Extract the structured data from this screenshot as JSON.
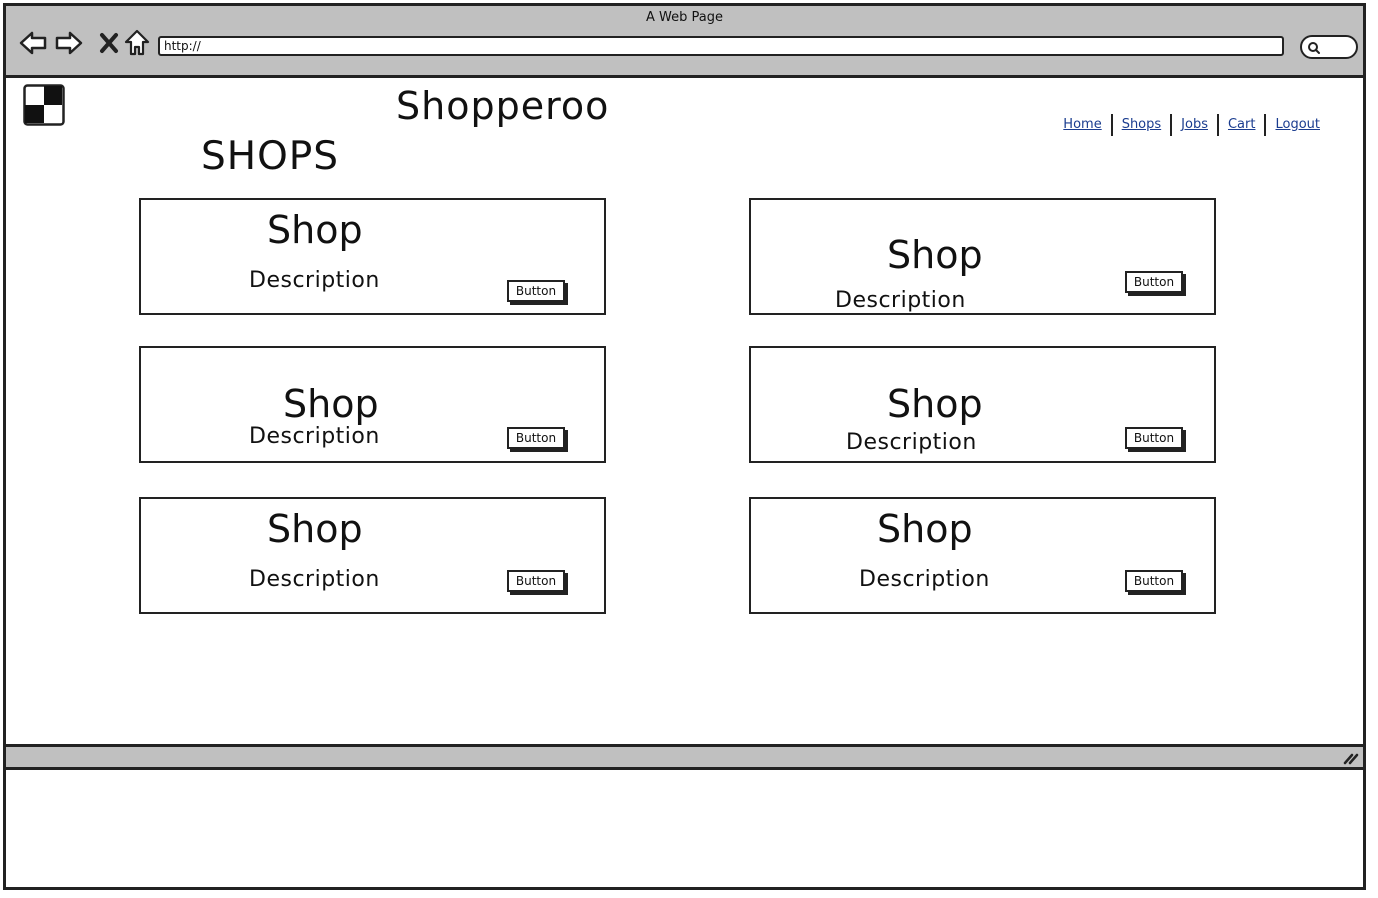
{
  "window": {
    "title": "A Web Page",
    "url": "http://"
  },
  "header": {
    "app_title": "Shopperoo",
    "page_heading": "SHOPS",
    "nav": [
      "Home",
      "Shops",
      "Jobs",
      "Cart",
      "Logout"
    ]
  },
  "shops": [
    {
      "title": "Shop",
      "description": "Description",
      "button": "Button"
    },
    {
      "title": "Shop",
      "description": "Description",
      "button": "Button"
    },
    {
      "title": "Shop",
      "description": "Description",
      "button": "Button"
    },
    {
      "title": "Shop",
      "description": "Description",
      "button": "Button"
    },
    {
      "title": "Shop",
      "description": "Description",
      "button": "Button"
    },
    {
      "title": "Shop",
      "description": "Description",
      "button": "Button"
    }
  ],
  "icons": {
    "back": "back-arrow-icon",
    "forward": "forward-arrow-icon",
    "stop": "close-icon",
    "home": "home-icon",
    "search": "search-icon",
    "logo": "checkerboard-logo-icon",
    "resize": "resize-grip-icon"
  },
  "colors": {
    "chrome": "#c0c0c0",
    "link": "#1a3c8f",
    "ink": "#222222"
  }
}
